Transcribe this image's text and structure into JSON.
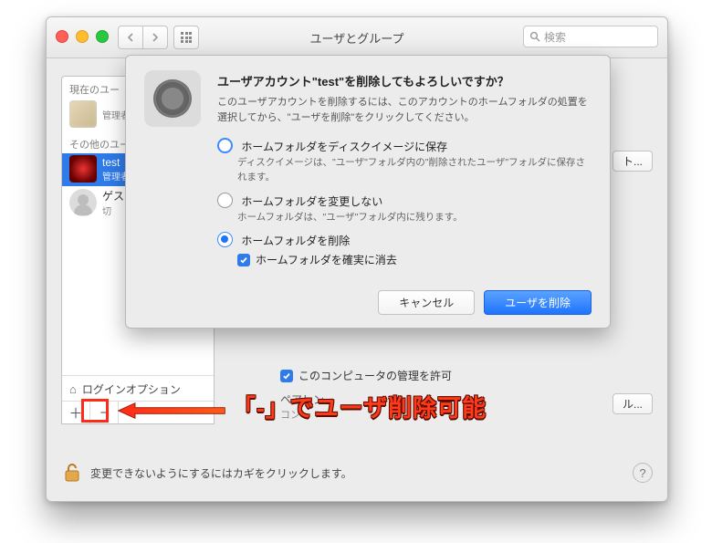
{
  "window": {
    "title": "ユーザとグループ",
    "search_placeholder": "検索"
  },
  "sidebar": {
    "section_current": "現在のユー",
    "section_other": "その他のユー",
    "user_current": {
      "name": "",
      "role": "管理者"
    },
    "user_test": {
      "name": "test",
      "role": "管理者"
    },
    "user_guest": {
      "name": "ゲス",
      "role": "切"
    },
    "login_options": "ログインオプション"
  },
  "details": {
    "open_btn": "ト...",
    "admin_checkbox": "このコンピュータの管理を許可",
    "parental_label": "ペアレン",
    "parental_sub": "コン",
    "parental_btn": "ル..."
  },
  "lock": {
    "text": "変更できないようにするにはカギをクリックします。"
  },
  "dialog": {
    "title_prefix": "ユーザアカウント",
    "title_quoted": "\"test\"",
    "title_suffix": "を削除してもよろしいですか？",
    "desc": "このユーザアカウントを削除するには、このアカウントのホームフォルダの処置を選択してから、\"ユーザを削除\"をクリックしてください。",
    "opt1": {
      "label": "ホームフォルダをディスクイメージに保存",
      "hint": "ディスクイメージは、\"ユーザ\"フォルダ内の\"削除されたユーザ\"フォルダに保存されます。"
    },
    "opt2": {
      "label": "ホームフォルダを変更しない",
      "hint": "ホームフォルダは、\"ユーザ\"フォルダ内に残ります。"
    },
    "opt3": {
      "label": "ホームフォルダを削除",
      "secure": "ホームフォルダを確実に消去"
    },
    "cancel": "キャンセル",
    "confirm": "ユーザを削除"
  },
  "annotation": {
    "text": "「-」でユーザ削除可能"
  }
}
